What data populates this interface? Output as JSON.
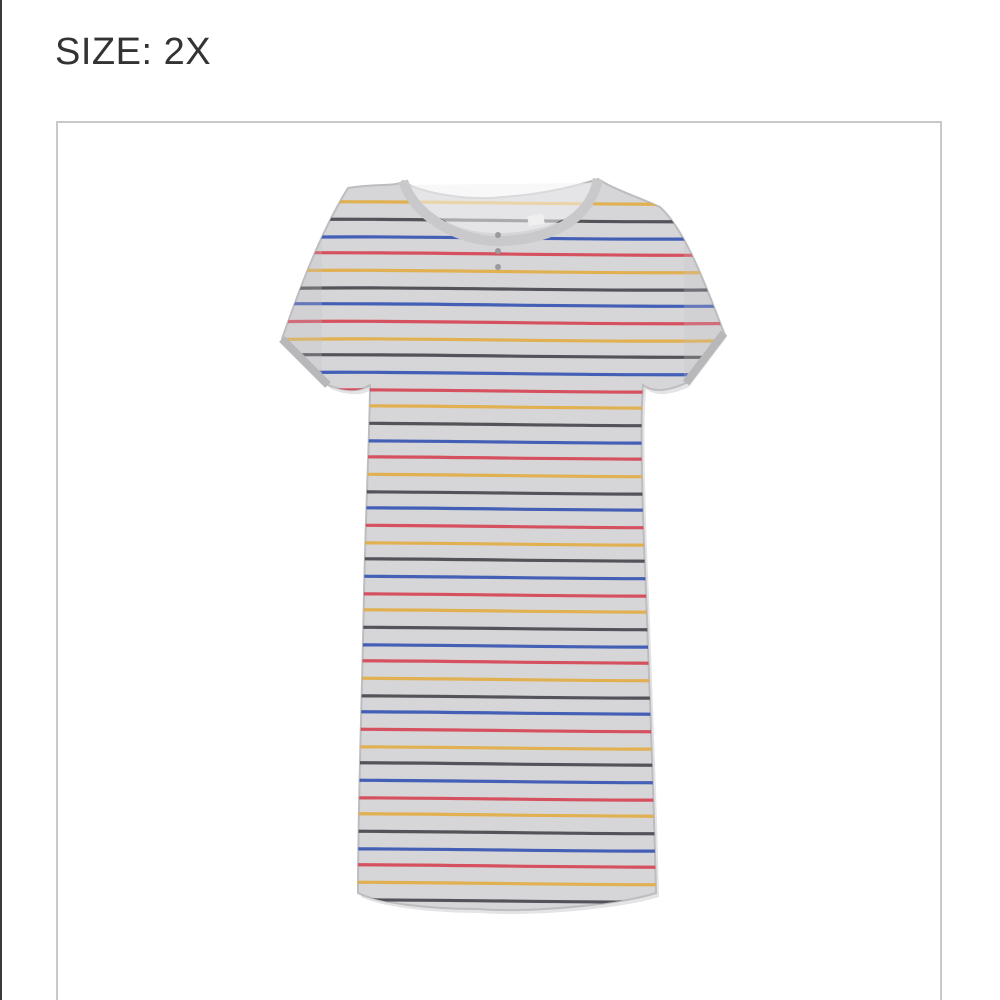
{
  "size": {
    "label": "SIZE: 2X"
  },
  "product_image": {
    "icon": "striped-t-shirt-dress-image",
    "colors": {
      "fabric": "#d6d6d8",
      "fabric_shade": "#c4c4c6",
      "stripe_charcoal": "#3c3d44",
      "stripe_red": "#d63a4a",
      "stripe_blue": "#2a4ab0",
      "stripe_yellow": "#e3a93a",
      "frame_border": "#c9c9c9"
    }
  }
}
